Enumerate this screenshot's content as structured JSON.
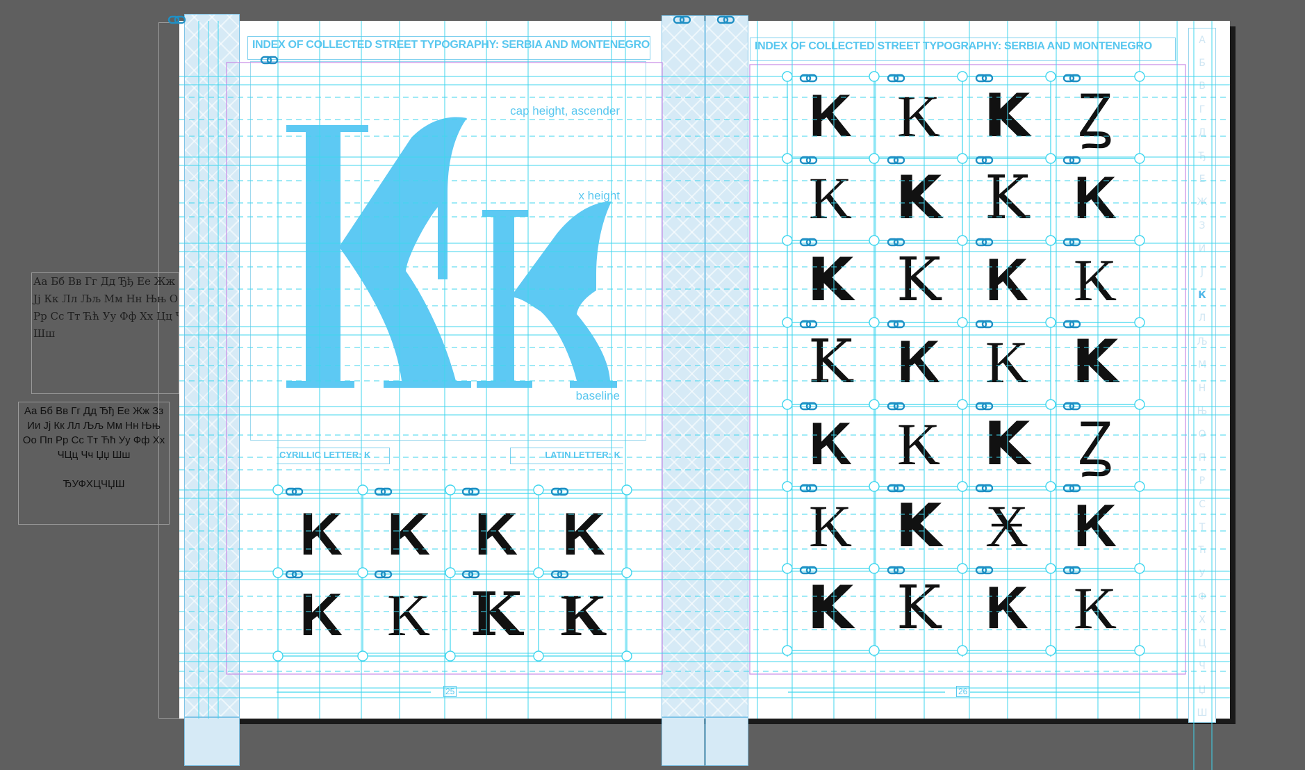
{
  "colors": {
    "guide": "#3fd6ee",
    "accent": "#59c7ef",
    "spine": "#d6eaf6",
    "margin_frame": "#c88ae6"
  },
  "header": {
    "left_title": "INDEX OF COLLECTED STREET TYPOGRAPHY:  SERBIA AND MONTENEGRO",
    "right_title": "INDEX OF COLLECTED STREET TYPOGRAPHY:  SERBIA AND MONTENEGRO"
  },
  "specimen": {
    "glyphs": "Kk",
    "labels": {
      "cap_height": "cap height, ascender",
      "x_height": "x height",
      "baseline": "baseline"
    },
    "caption_left": "CYRILLIC LETTER: K",
    "caption_right": "LATIN LETTER: K"
  },
  "left_grid_glyphs": [
    "K",
    "K",
    "K",
    "K",
    "K",
    "K",
    "K",
    "K"
  ],
  "right_grid_glyphs": [
    "K",
    "K",
    "K",
    "Ꙁ",
    "K",
    "K",
    "K",
    "K",
    "K",
    "K",
    "K",
    "K",
    "K",
    "K",
    "K",
    "K",
    "K",
    "K",
    "K",
    "Ꙁ",
    "K",
    "K",
    "Ӿ",
    "K",
    "K",
    "K",
    "K",
    "K"
  ],
  "pages": {
    "left": "25",
    "right": "26"
  },
  "pasteboard": {
    "alphabet_serif_lines": [
      "Аа Бб Вв Гг Дд Ђђ Ее Жж Зз Ии",
      "Јј Кк Лл Љљ Мм Нн Њњ Оо Пп",
      "Рр Сс Тт Ћћ Уу Фф Хх Цц Чч Џџ",
      "Шш"
    ],
    "alphabet_sans_lines": [
      "Аа Бб Вв Гг Дд Ђђ Ее Жж Зз",
      "Ии Јј Кк Лл Љљ Мм Нн Њњ",
      "Оо Пп Рр Сс Тт Ћћ Уу Фф Хх",
      "ЧЦц Чч Џџ Шш",
      "",
      "ЂУФХЦЧЏШ"
    ]
  },
  "alphabet_index": [
    "А",
    "Б",
    "В",
    "Г",
    "Д",
    "Ђ",
    "Е",
    "Ж",
    "З",
    "И",
    "Ј",
    "К",
    "Л",
    "Љ",
    "М",
    "Н",
    "Њ",
    "О",
    "П",
    "Р",
    "С",
    "Т",
    "Ћ",
    "У",
    "Ф",
    "Х",
    "Ц",
    "Ч",
    "Џ",
    "Ш"
  ],
  "alphabet_index_active": "К",
  "icons": [
    "link-icon"
  ]
}
